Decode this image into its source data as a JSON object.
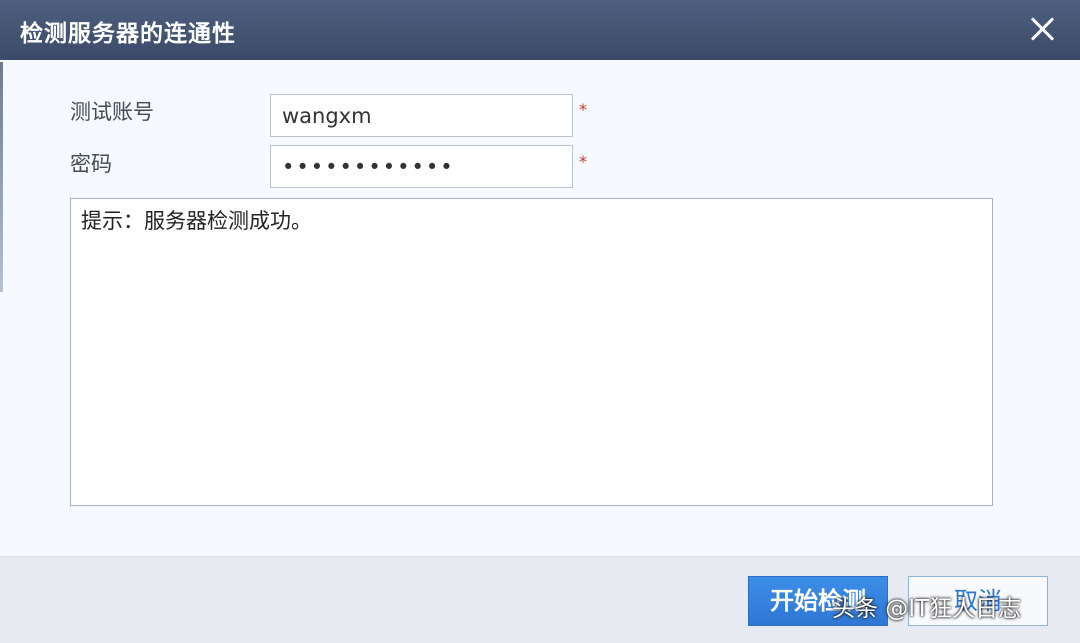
{
  "dialog": {
    "title": "检测服务器的连通性",
    "close_icon": "close-icon"
  },
  "form": {
    "account_label": "测试账号",
    "account_value": "wangxm",
    "password_label": "密码",
    "password_value": "••••••••••••",
    "required_mark": "*"
  },
  "result": {
    "message": "提示：服务器检测成功。"
  },
  "footer": {
    "start_label": "开始检测",
    "cancel_label": "取消"
  },
  "watermark": {
    "text": "头条 @IT狂人日志"
  },
  "colors": {
    "titlebar": "#3f4e6d",
    "primary_button": "#2f77d4",
    "required": "#c0392b"
  }
}
